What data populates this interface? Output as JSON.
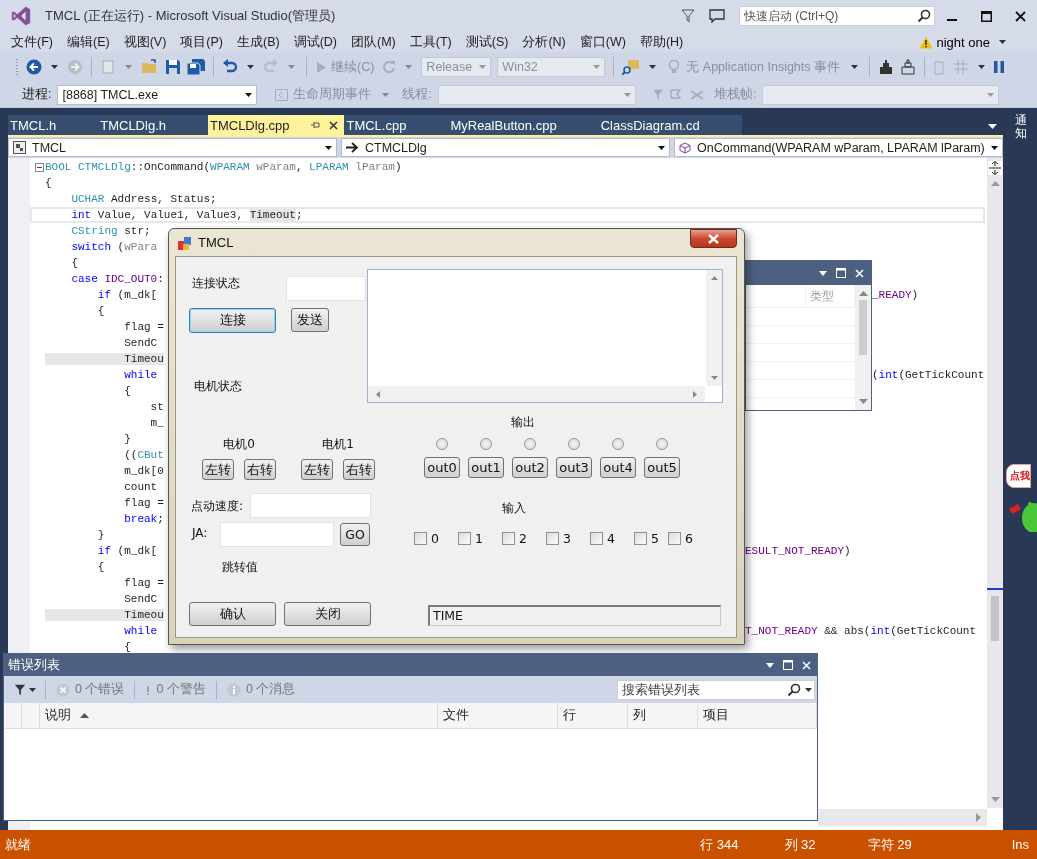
{
  "window": {
    "title": "TMCL (正在运行) - Microsoft Visual Studio(管理员)"
  },
  "quick_launch": {
    "placeholder": "快速启动 (Ctrl+Q)"
  },
  "menu": [
    "文件(F)",
    "编辑(E)",
    "视图(V)",
    "项目(P)",
    "生成(B)",
    "调试(D)",
    "团队(M)",
    "工具(T)",
    "测试(S)",
    "分析(N)",
    "窗口(W)",
    "帮助(H)"
  ],
  "account": {
    "name": "night one"
  },
  "toolbar": {
    "continue": "继续(C)",
    "configuration": "Release",
    "platform": "Win32",
    "insights": "无 Application Insights 事件"
  },
  "debug_bar": {
    "process_label": "进程:",
    "process": "[8868] TMCL.exe",
    "lifecycle": "生命周期事件",
    "thread_label": "线程:",
    "stack_label": "堆栈帧:"
  },
  "tabs": [
    {
      "label": "TMCL.h",
      "selected": false
    },
    {
      "label": "TMCLDlg.h",
      "selected": false
    },
    {
      "label": "TMCLDlg.cpp",
      "selected": true
    },
    {
      "label": "TMCL.cpp",
      "selected": false
    },
    {
      "label": "MyRealButton.cpp",
      "selected": false
    },
    {
      "label": "ClassDiagram.cd",
      "selected": false
    }
  ],
  "notifications": {
    "label": "通知"
  },
  "nav": {
    "project": "TMCL",
    "class": "CTMCLDlg",
    "member": "OnCommand(WPARAM wParam, LPARAM lParam)"
  },
  "code": {
    "lines": [
      {
        "current": false,
        "segments": [
          {
            "text": "BOOL",
            "kind": "type"
          },
          {
            "text": " CTMCLDlg",
            "kind": "type"
          },
          {
            "text": "::OnCommand(",
            "kind": "plain"
          },
          {
            "text": "WPARAM",
            "kind": "type"
          },
          {
            "text": " wParam",
            "kind": "param"
          },
          {
            "text": ", ",
            "kind": "plain"
          },
          {
            "text": "LPARAM",
            "kind": "type"
          },
          {
            "text": " lParam",
            "kind": "param"
          },
          {
            "text": ")",
            "kind": "plain"
          }
        ]
      },
      {
        "current": false,
        "segments": [
          {
            "text": "{",
            "kind": "plain"
          }
        ]
      },
      {
        "current": false,
        "segments": [
          {
            "text": "    UCHAR",
            "kind": "type"
          },
          {
            "text": " Address, Status;",
            "kind": "plain"
          }
        ]
      },
      {
        "current": true,
        "segments": [
          {
            "text": "    int",
            "kind": "kw"
          },
          {
            "text": " Value, Value1, Value3, ",
            "kind": "plain"
          },
          {
            "text": "Timeout",
            "kind": "ref"
          },
          {
            "text": ";",
            "kind": "plain"
          }
        ]
      },
      {
        "current": false,
        "segments": [
          {
            "text": "    CString",
            "kind": "type"
          },
          {
            "text": " str;",
            "kind": "plain"
          }
        ]
      },
      {
        "current": false,
        "segments": [
          {
            "text": "    switch",
            "kind": "kw"
          },
          {
            "text": " (",
            "kind": "plain"
          },
          {
            "text": "wPara",
            "kind": "param"
          }
        ]
      },
      {
        "current": false,
        "segments": [
          {
            "text": "    {",
            "kind": "plain"
          }
        ]
      },
      {
        "current": false,
        "segments": [
          {
            "text": "    case",
            "kind": "kw"
          },
          {
            "text": " IDC_OUT0",
            "kind": "macro"
          },
          {
            "text": ":",
            "kind": "plain"
          }
        ]
      },
      {
        "current": false,
        "segments": [
          {
            "text": "        if",
            "kind": "kw"
          },
          {
            "text": " (m_dk[",
            "kind": "plain"
          }
        ],
        "tail": {
          "kind": "panel",
          "segments": [
            {
              "text": "_READY",
              "kind": "macro"
            },
            {
              "text": ")",
              "kind": "plain"
            }
          ]
        }
      },
      {
        "current": false,
        "segments": [
          {
            "text": "        {",
            "kind": "plain"
          }
        ]
      },
      {
        "current": false,
        "segments": [
          {
            "text": "            flag =",
            "kind": "plain"
          }
        ]
      },
      {
        "current": false,
        "segments": [
          {
            "text": "            SendC",
            "kind": "plain"
          }
        ]
      },
      {
        "current": false,
        "segments": [
          {
            "text": "            Timeou",
            "kind": "ref"
          }
        ]
      },
      {
        "current": false,
        "segments": [
          {
            "text": "            while",
            "kind": "kw"
          }
        ],
        "tail": {
          "kind": "panel",
          "segments": [
            {
              "text": "(",
              "kind": "plain"
            },
            {
              "text": "int",
              "kind": "kw"
            },
            {
              "text": "(GetTickCount",
              "kind": "plain"
            }
          ]
        }
      },
      {
        "current": false,
        "segments": [
          {
            "text": "            {",
            "kind": "plain"
          }
        ]
      },
      {
        "current": false,
        "segments": [
          {
            "text": "                st",
            "kind": "plain"
          }
        ]
      },
      {
        "current": false,
        "segments": [
          {
            "text": "                m_",
            "kind": "plain"
          }
        ]
      },
      {
        "current": false,
        "segments": [
          {
            "text": "            }",
            "kind": "plain"
          }
        ]
      },
      {
        "current": false,
        "segments": [
          {
            "text": "            ((",
            "kind": "plain"
          },
          {
            "text": "CBut",
            "kind": "type"
          }
        ]
      },
      {
        "current": false,
        "segments": [
          {
            "text": "            m_dk[0",
            "kind": "plain"
          }
        ]
      },
      {
        "current": false,
        "segments": [
          {
            "text": "            count",
            "kind": "plain"
          }
        ]
      },
      {
        "current": false,
        "segments": [
          {
            "text": "            flag =",
            "kind": "plain"
          }
        ]
      },
      {
        "current": false,
        "segments": [
          {
            "text": "            break",
            "kind": "kw"
          },
          {
            "text": ";",
            "kind": "plain"
          }
        ]
      },
      {
        "current": false,
        "segments": [
          {
            "text": "        }",
            "kind": "plain"
          }
        ]
      },
      {
        "current": false,
        "segments": [
          {
            "text": "        if",
            "kind": "kw"
          },
          {
            "text": " (m_dk[",
            "kind": "plain"
          }
        ],
        "tail": {
          "kind": "dialog",
          "segments": [
            {
              "text": "ESULT_NOT_READY",
              "kind": "macro"
            },
            {
              "text": ")",
              "kind": "plain"
            }
          ]
        }
      },
      {
        "current": false,
        "segments": [
          {
            "text": "        {",
            "kind": "plain"
          }
        ]
      },
      {
        "current": false,
        "segments": [
          {
            "text": "            flag =",
            "kind": "plain"
          }
        ]
      },
      {
        "current": false,
        "segments": [
          {
            "text": "            SendC",
            "kind": "plain"
          }
        ]
      },
      {
        "current": false,
        "segments": [
          {
            "text": "            Timeou",
            "kind": "ref"
          }
        ]
      },
      {
        "current": false,
        "segments": [
          {
            "text": "            while",
            "kind": "kw"
          }
        ],
        "tail": {
          "kind": "dialog",
          "segments": [
            {
              "text": "T_NOT_READY",
              "kind": "macro"
            },
            {
              "text": " && abs(",
              "kind": "plain"
            },
            {
              "text": "int",
              "kind": "kw"
            },
            {
              "text": "(GetTickCount",
              "kind": "plain"
            }
          ]
        }
      },
      {
        "current": false,
        "segments": [
          {
            "text": "            {",
            "kind": "plain"
          }
        ]
      }
    ]
  },
  "side_panel": {
    "column_header": "类型"
  },
  "dialog": {
    "title": "TMCL",
    "connection_label": "连接状态",
    "connect_button": "连接",
    "send_button": "发送",
    "motor_status_label": "电机状态",
    "output_label": "输出",
    "motors": [
      {
        "label": "电机0",
        "left": "左转",
        "right": "右转"
      },
      {
        "label": "电机1",
        "left": "左转",
        "right": "右转"
      }
    ],
    "outputs": [
      {
        "label": "out0",
        "selected": false
      },
      {
        "label": "out1",
        "selected": false
      },
      {
        "label": "out2",
        "selected": false
      },
      {
        "label": "out3",
        "selected": false
      },
      {
        "label": "out4",
        "selected": false
      },
      {
        "label": "out5",
        "selected": false
      }
    ],
    "jog_speed_label": "点动速度:",
    "input_label": "输入",
    "ja_label": "JA:",
    "go_button": "GO",
    "jump_label": "跳转值",
    "inputs": [
      {
        "label": "0",
        "checked": false
      },
      {
        "label": "1",
        "checked": false
      },
      {
        "label": "2",
        "checked": false
      },
      {
        "label": "3",
        "checked": false
      },
      {
        "label": "4",
        "checked": false
      },
      {
        "label": "5",
        "checked": false
      },
      {
        "label": "6",
        "checked": false
      }
    ],
    "ok_button": "确认",
    "close_button": "关闭",
    "time": "TIME"
  },
  "error_list": {
    "title": "错误列表",
    "filters": [
      {
        "label": "0 个错误",
        "kind": "error"
      },
      {
        "label": "0 个警告",
        "kind": "warning"
      },
      {
        "label": "0 个消息",
        "kind": "message"
      }
    ],
    "search": {
      "placeholder": "搜索错误列表"
    },
    "columns": [
      "说明",
      "文件",
      "行",
      "列",
      "项目"
    ]
  },
  "sticker": {
    "text": "点我"
  },
  "status_bar": {
    "message": "就绪",
    "items": [
      "行 344",
      "列 32",
      "字符 29",
      "Ins"
    ]
  }
}
